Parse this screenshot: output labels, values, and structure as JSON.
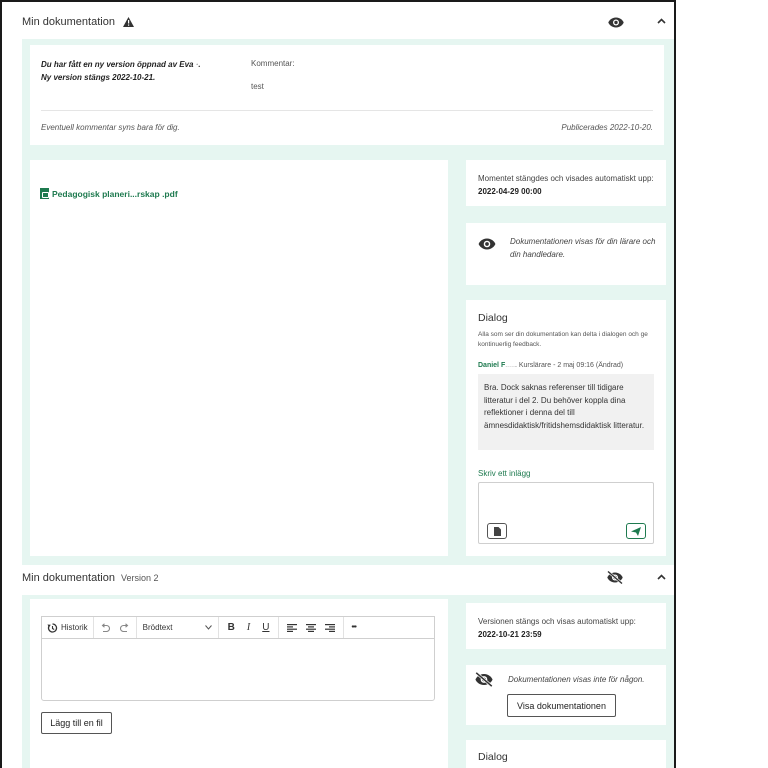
{
  "section1": {
    "title": "Min dokumentation",
    "notice": {
      "line1": "Du har fått en ny version öppnad av Eva ",
      "line1_redacted_suffix": "·",
      "line1_end": ".",
      "line2": "Ny version stängs 2022-10-21.",
      "comment_label": "Kommentar:",
      "comment_value": "test",
      "footer_left": "Eventuell kommentar syns bara för dig.",
      "footer_right": "Publicerades 2022-10-20."
    },
    "file_link": "Pedagogisk planeri...rskap .pdf",
    "closed_info": {
      "text": "Momentet stängdes och visades automatiskt upp:",
      "date": "2022-04-29 00:00"
    },
    "visibility": {
      "text": "Dokumentationen visas för din lärare och din handledare."
    },
    "dialog": {
      "title": "Dialog",
      "description": "Alla som ser din dokumentation kan delta i dialogen och ge kontinuerlig feedback.",
      "author": "Daniel F",
      "author_meta": "Kurslärare - 2 maj 09:16 (Ändrad)",
      "message": "Bra. Dock saknas referenser till tidigare litteratur i del 2. Du behöver koppla dina reflektioner i denna del till ämnesdidaktisk/fritidshemsdidaktisk litteratur.",
      "write_label": "Skriv ett inlägg"
    }
  },
  "section2": {
    "title": "Min dokumentation",
    "version": "Version 2",
    "toolbar": {
      "history": "Historik",
      "style": "Brödtext",
      "bold": "B",
      "italic": "I",
      "underline": "U",
      "more": "•••"
    },
    "add_file": "Lägg till en fil",
    "closes_info": {
      "text": "Versionen stängs och visas automatiskt upp:",
      "date": "2022-10-21 23:59"
    },
    "visibility": {
      "text": "Dokumentationen visas inte för någon.",
      "button": "Visa dokumentationen"
    },
    "dialog_title": "Dialog"
  },
  "colors": {
    "accent": "#1e7a4f",
    "panel_bg": "#e6f6f1"
  }
}
